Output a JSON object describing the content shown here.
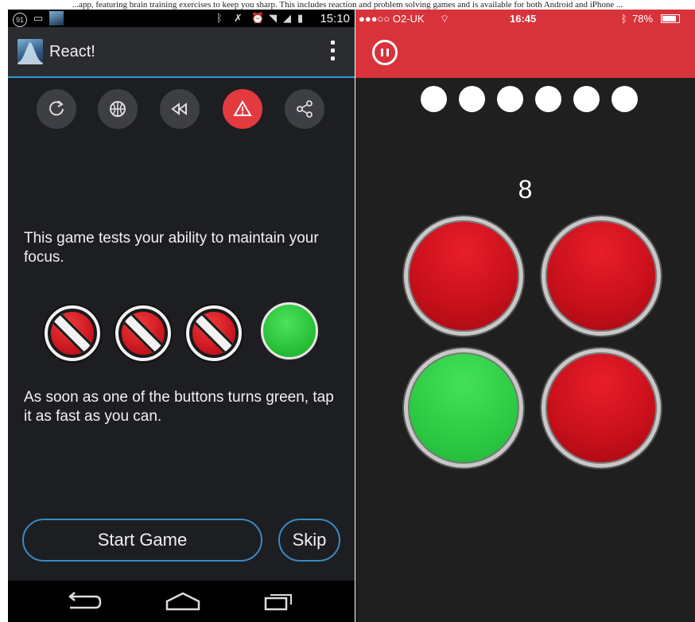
{
  "caption": "...app, featuring brain training exercises to keep you sharp. This includes reaction and problem solving games and is available for both Android and iPhone ...",
  "android": {
    "status": {
      "time": "15:10",
      "notification_count": "91"
    },
    "app_title": "React!",
    "toolbar_icons": [
      "refresh-icon",
      "basketball-icon",
      "rewind-icon",
      "alert-icon",
      "share-icon"
    ],
    "instruction_1": "This game tests your ability to maintain your focus.",
    "instruction_2": "As soon as one of the buttons turns green, tap it as fast as you can.",
    "start_button": "Start Game",
    "skip_button": "Skip",
    "colors": {
      "accent": "#2e9ad6",
      "alert": "#e33a3f"
    }
  },
  "ios": {
    "status": {
      "carrier": "●●●○○ O2-UK",
      "time": "16:45",
      "battery": "78%"
    },
    "progress_dots": 6,
    "counter": "8",
    "buttons": [
      "red",
      "red",
      "green",
      "red"
    ],
    "colors": {
      "header": "#d8333b",
      "red": "#c9101b",
      "green": "#2dcc44"
    }
  }
}
